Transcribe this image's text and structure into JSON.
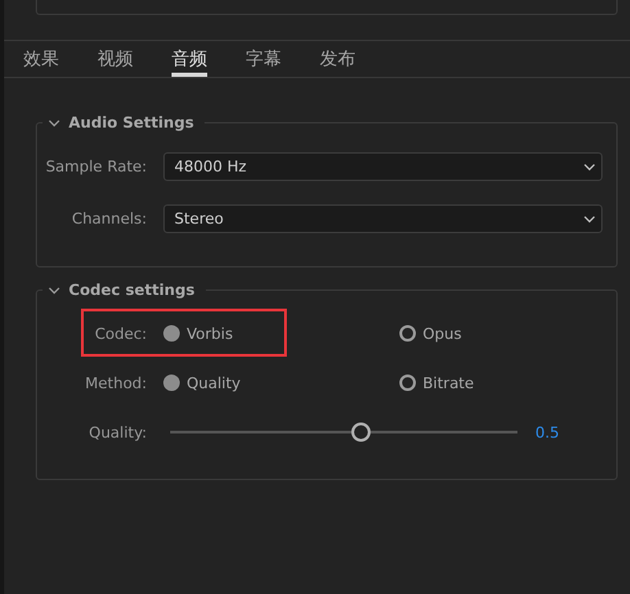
{
  "tabs": [
    {
      "label": "效果",
      "selected": false
    },
    {
      "label": "视频",
      "selected": false
    },
    {
      "label": "音频",
      "selected": true
    },
    {
      "label": "字幕",
      "selected": false
    },
    {
      "label": "发布",
      "selected": false
    }
  ],
  "audio_settings": {
    "title": "Audio Settings",
    "expanded": true,
    "fields": [
      {
        "label": "Sample Rate:",
        "value": "48000 Hz"
      },
      {
        "label": "Channels:",
        "value": "Stereo"
      }
    ]
  },
  "codec_settings": {
    "title": "Codec settings",
    "expanded": true,
    "rows": [
      {
        "kind": "radio",
        "label": "Codec:",
        "highlighted": true,
        "options": [
          {
            "label": "Vorbis",
            "selected": true
          },
          {
            "label": "Opus",
            "selected": false
          }
        ]
      },
      {
        "kind": "radio",
        "label": "Method:",
        "highlighted": false,
        "options": [
          {
            "label": "Quality",
            "selected": true
          },
          {
            "label": "Bitrate",
            "selected": false
          }
        ]
      },
      {
        "kind": "slider",
        "label": "Quality:",
        "level": 0.55,
        "reading": "0.5"
      }
    ]
  }
}
